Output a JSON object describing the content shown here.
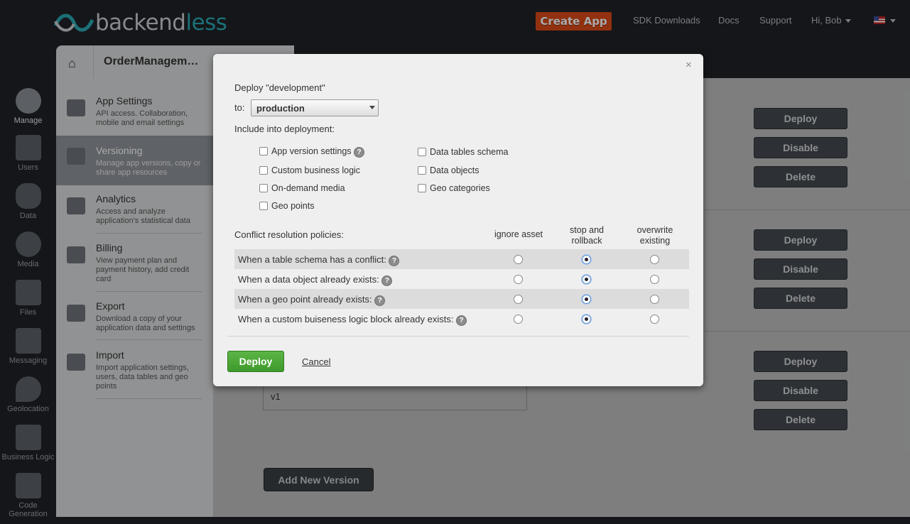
{
  "header": {
    "logo_back": "backend",
    "logo_less": "less",
    "create_app": "Create App",
    "links": [
      "SDK Downloads",
      "Docs",
      "Support"
    ],
    "user": "Hi, Bob"
  },
  "left_nav": [
    {
      "label": "Manage",
      "icon": "gear-icon"
    },
    {
      "label": "Users",
      "icon": "users-icon"
    },
    {
      "label": "Data",
      "icon": "database-icon"
    },
    {
      "label": "Media",
      "icon": "media-icon"
    },
    {
      "label": "Files",
      "icon": "folder-icon"
    },
    {
      "label": "Messaging",
      "icon": "envelope-icon"
    },
    {
      "label": "Geolocation",
      "icon": "map-pin-icon"
    },
    {
      "label": "Business Logic",
      "icon": "code-icon"
    },
    {
      "label": "Code",
      "label2": "Generation",
      "icon": "flask-icon"
    }
  ],
  "app_header": {
    "app_name": "OrderManagem…"
  },
  "side_panel": [
    {
      "title": "App Settings",
      "desc": "API access. Collaboration, mobile and email settings"
    },
    {
      "title": "Versioning",
      "desc": "Manage app versions, copy or share app resources"
    },
    {
      "title": "Analytics",
      "desc": "Access and analyze application's statistical data"
    },
    {
      "title": "Billing",
      "desc": "View payment plan and payment history, add credit card"
    },
    {
      "title": "Export",
      "desc": "Download a copy of your application data and settings"
    },
    {
      "title": "Import",
      "desc": "Import application settings, users, data tables and geo points"
    }
  ],
  "content": {
    "deploy": "Deploy",
    "disable": "Disable",
    "delete": "Delete",
    "version_value": "v1",
    "add_version": "Add New Version"
  },
  "modal": {
    "close": "×",
    "title": "Deploy \"development\"",
    "to_label": "to:",
    "target": "production",
    "include_label": "Include into deployment:",
    "checkboxes_left": [
      "App version settings",
      "Custom business logic",
      "On-demand media",
      "Geo points"
    ],
    "checkboxes_right": [
      "Data tables schema",
      "Data objects",
      "Geo categories"
    ],
    "conflict_label": "Conflict resolution policies:",
    "columns": [
      "ignore asset",
      "stop and rollback",
      "overwrite existing"
    ],
    "policies": [
      {
        "label": "When a table schema has a conflict:",
        "selected": "stop and rollback"
      },
      {
        "label": "When a data object already exists:",
        "selected": "stop and rollback"
      },
      {
        "label": "When a geo point already exists:",
        "selected": "stop and rollback"
      },
      {
        "label": "When a custom buiseness logic block already exists:",
        "selected": "stop and rollback"
      }
    ],
    "help": "?",
    "deploy_button": "Deploy",
    "cancel": "Cancel"
  }
}
